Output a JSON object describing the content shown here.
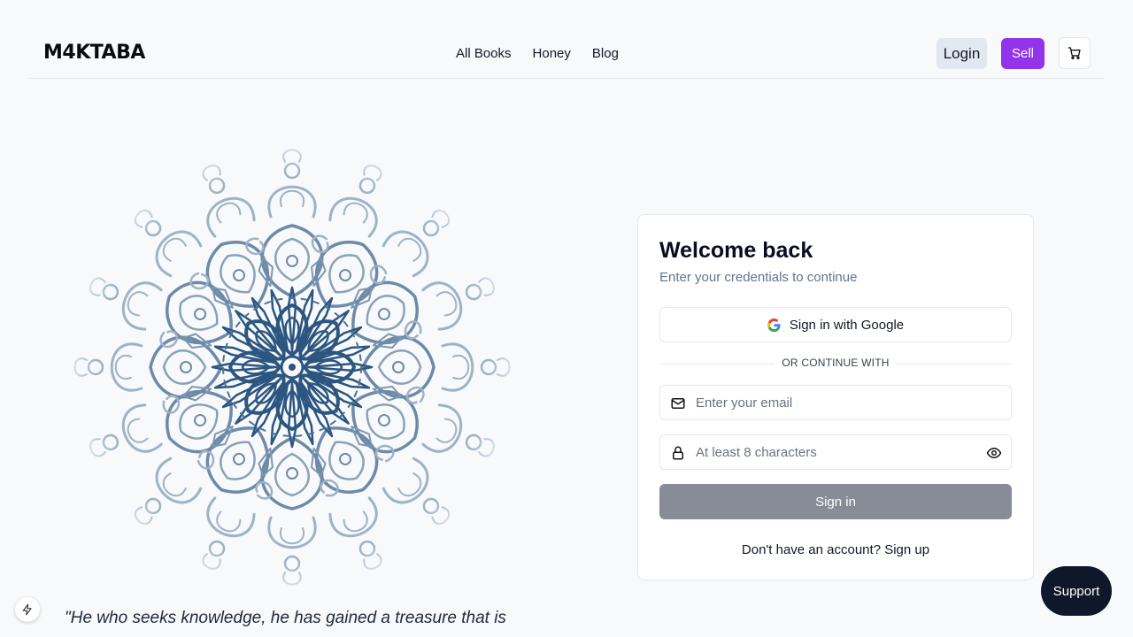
{
  "header": {
    "logo": "M4KTABA",
    "nav": [
      {
        "label": "All Books"
      },
      {
        "label": "Honey"
      },
      {
        "label": "Blog"
      }
    ],
    "login_label": "Login",
    "sell_label": "Sell",
    "cart_icon": "shopping-cart-icon"
  },
  "hero": {
    "quote": "\"He who seeks knowledge, he has gained a treasure that is"
  },
  "login_card": {
    "title": "Welcome back",
    "subtitle": "Enter your credentials to continue",
    "google_label": "Sign in with Google",
    "divider": "OR CONTINUE WITH",
    "email_placeholder": "Enter your email",
    "password_placeholder": "At least 8 characters",
    "signin_label": "Sign in",
    "signup_prompt": "Don't have an account?",
    "signup_link": "Sign up"
  },
  "support_label": "Support",
  "colors": {
    "accent": "#9333ea",
    "mandala_dark": "#2c5680",
    "mandala_light": "#9fb2c6",
    "signin_disabled": "#878c96"
  }
}
